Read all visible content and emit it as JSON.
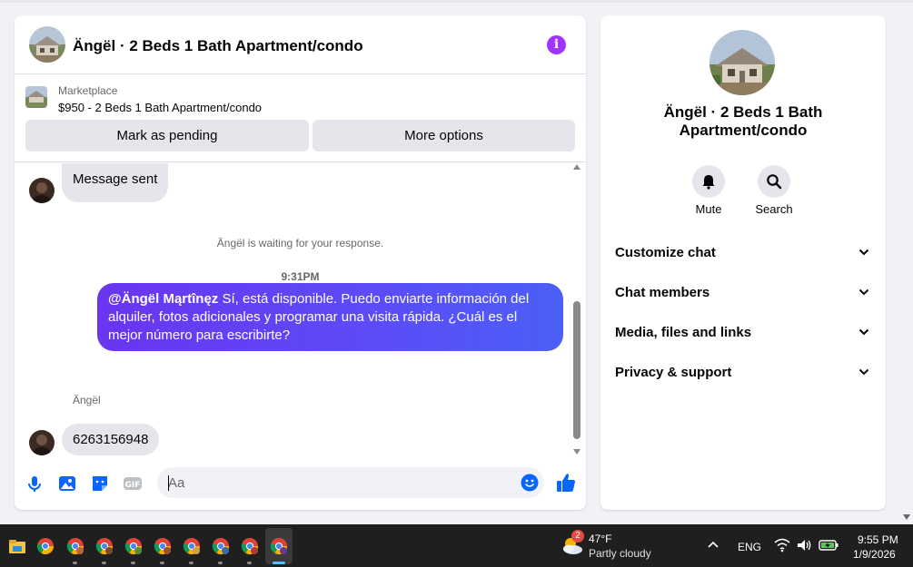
{
  "chat": {
    "header_title": "Ängël · 2 Beds 1 Bath Apartment/condo",
    "marketplace": {
      "label": "Marketplace",
      "listing": "$950 - 2 Beds 1 Bath Apartment/condo",
      "mark_pending": "Mark as pending",
      "more_options": "More options"
    },
    "messages": {
      "message_sent": "Message sent",
      "waiting": "Ängël is waiting for your response.",
      "time": "9:31PM",
      "outgoing_mention": "@Ängël Mąrtînęz",
      "outgoing_text": " Sí, está disponible. Puedo enviarte información del alquiler, fotos adicionales y programar una visita rápida. ¿Cuál es el mejor número para escribirte?",
      "sender_name": "Ängël",
      "incoming_number": "6263156948"
    },
    "composer": {
      "placeholder": "Aa",
      "value": ""
    }
  },
  "side": {
    "title": "Ängël · 2 Beds 1 Bath Apartment/condo",
    "actions": [
      {
        "label": "Mute",
        "icon": "bell-icon"
      },
      {
        "label": "Search",
        "icon": "search-icon"
      }
    ],
    "sections": [
      "Customize chat",
      "Chat members",
      "Media, files and links",
      "Privacy & support"
    ]
  },
  "taskbar": {
    "weather_temp": "47°F",
    "weather_desc": "Partly cloudy",
    "weather_badge": "2",
    "language": "ENG",
    "time": "9:55 PM",
    "date": "1/9/2026"
  },
  "colors": {
    "accent": "#a033ff",
    "outgoing_bubble": "#5b4cf7",
    "messenger_blue": "#0866ff",
    "taskbar": "#1f1f1f"
  }
}
